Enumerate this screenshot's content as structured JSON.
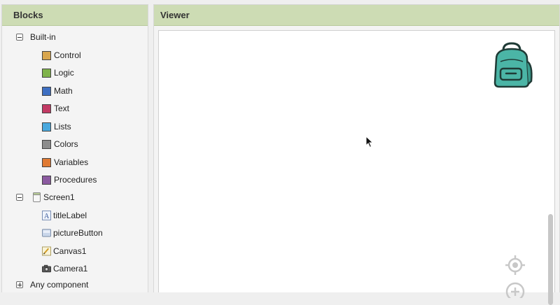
{
  "blocks_panel": {
    "title": "Blocks",
    "builtin": {
      "label": "Built-in",
      "items": [
        {
          "label": "Control",
          "color": "#d8a64e"
        },
        {
          "label": "Logic",
          "color": "#7fb34a"
        },
        {
          "label": "Math",
          "color": "#3e6fc2"
        },
        {
          "label": "Text",
          "color": "#c23a64"
        },
        {
          "label": "Lists",
          "color": "#49a8dd"
        },
        {
          "label": "Colors",
          "color": "#8c8c8c"
        },
        {
          "label": "Variables",
          "color": "#e07a33"
        },
        {
          "label": "Procedures",
          "color": "#8b5aa0"
        }
      ]
    },
    "screen": {
      "label": "Screen1",
      "components": [
        {
          "label": "titleLabel",
          "icon": "label-icon"
        },
        {
          "label": "pictureButton",
          "icon": "button-icon"
        },
        {
          "label": "Canvas1",
          "icon": "canvas-icon"
        },
        {
          "label": "Camera1",
          "icon": "camera-icon"
        }
      ]
    },
    "any_component": {
      "label": "Any component"
    }
  },
  "viewer_panel": {
    "title": "Viewer"
  },
  "colors": {
    "header_bg": "#cddcb4",
    "backpack": "#4bb5a6"
  }
}
